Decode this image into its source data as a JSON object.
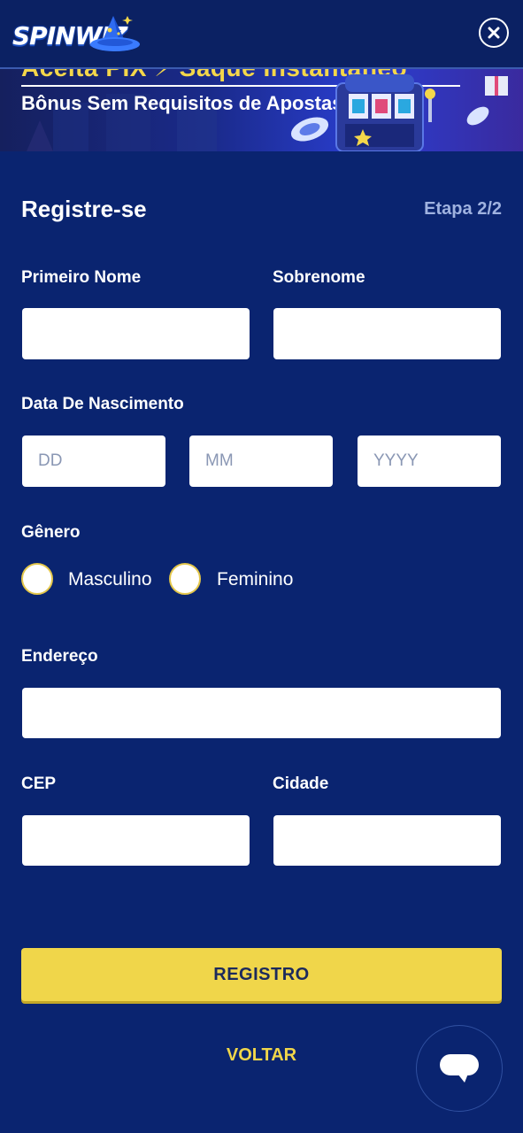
{
  "header": {
    "logo_text": "SPINWIZ",
    "close_icon": "close-icon"
  },
  "banner": {
    "headline": "Aceita PIX ⚡ Saque Instantâneo",
    "subtitle": "Bônus Sem Requisitos de Apostas!"
  },
  "form": {
    "title": "Registre-se",
    "step": "Etapa 2/2",
    "first_name": {
      "label": "Primeiro Nome",
      "value": "",
      "placeholder": ""
    },
    "last_name": {
      "label": "Sobrenome",
      "value": "",
      "placeholder": ""
    },
    "birth_date": {
      "label": "Data De Nascimento",
      "day_placeholder": "DD",
      "month_placeholder": "MM",
      "year_placeholder": "YYYY"
    },
    "gender": {
      "label": "Gênero",
      "options": [
        "Masculino",
        "Feminino"
      ]
    },
    "address": {
      "label": "Endereço",
      "value": "",
      "placeholder": ""
    },
    "zip": {
      "label": "CEP",
      "value": "",
      "placeholder": ""
    },
    "city": {
      "label": "Cidade",
      "value": "",
      "placeholder": ""
    },
    "register_button": "REGISTRO",
    "back_button": "VOLTAR"
  },
  "chat": {
    "icon": "chat-bubble-icon"
  },
  "colors": {
    "background": "#0a2470",
    "accent": "#f0d64a",
    "step_text": "#9fb2e0"
  }
}
